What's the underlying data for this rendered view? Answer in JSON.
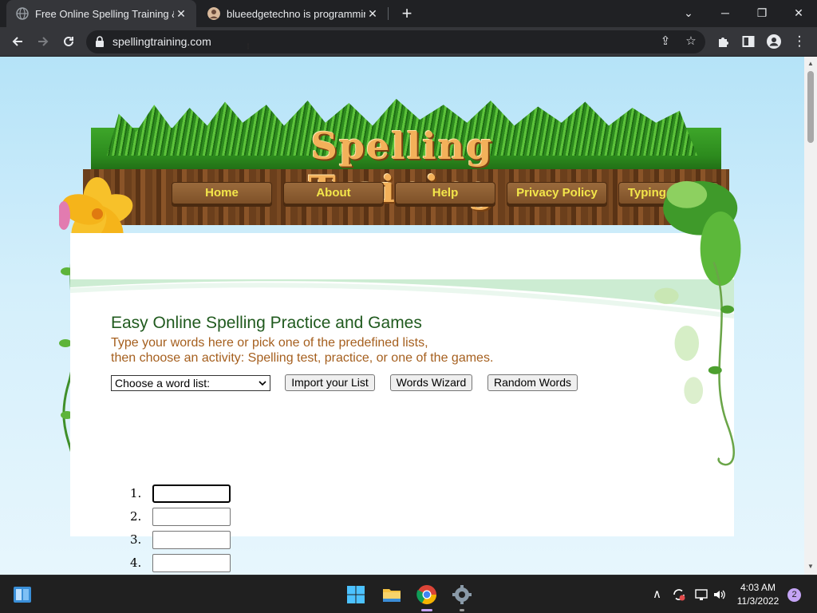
{
  "browser": {
    "tabs": [
      {
        "title": "Free Online Spelling Training & G",
        "close": "✕"
      },
      {
        "title": "blueedgetechno is programming",
        "close": "✕"
      }
    ],
    "new_tab": "+",
    "url": "spellingtraining.com",
    "window_controls": {
      "minimize": "─",
      "maximize": "❐",
      "close": "✕",
      "tab_search": "⌄"
    }
  },
  "site": {
    "title": "Spelling Training",
    "nav": [
      "Home",
      "About",
      "Help",
      "Privacy Policy",
      "Typing Games"
    ],
    "heading": "Easy Online Spelling Practice and Games",
    "subtitle_line1": "Type your words here or pick one of the predefined lists,",
    "subtitle_line2": "then choose an activity: Spelling test, practice, or one of the games.",
    "word_list_select": "Choose a word list:",
    "buttons": {
      "import": "Import your List",
      "wizard": "Words Wizard",
      "random": "Random Words"
    },
    "word_rows": [
      "1.",
      "2.",
      "3.",
      "4."
    ]
  },
  "taskbar": {
    "time": "4:03 AM",
    "date": "11/3/2022",
    "notifications": "2"
  },
  "colors": {
    "heading": "#205a1e",
    "subtitle": "#a55f1e",
    "nav_text": "#f3e64a",
    "title_text": "#f3b15a"
  }
}
